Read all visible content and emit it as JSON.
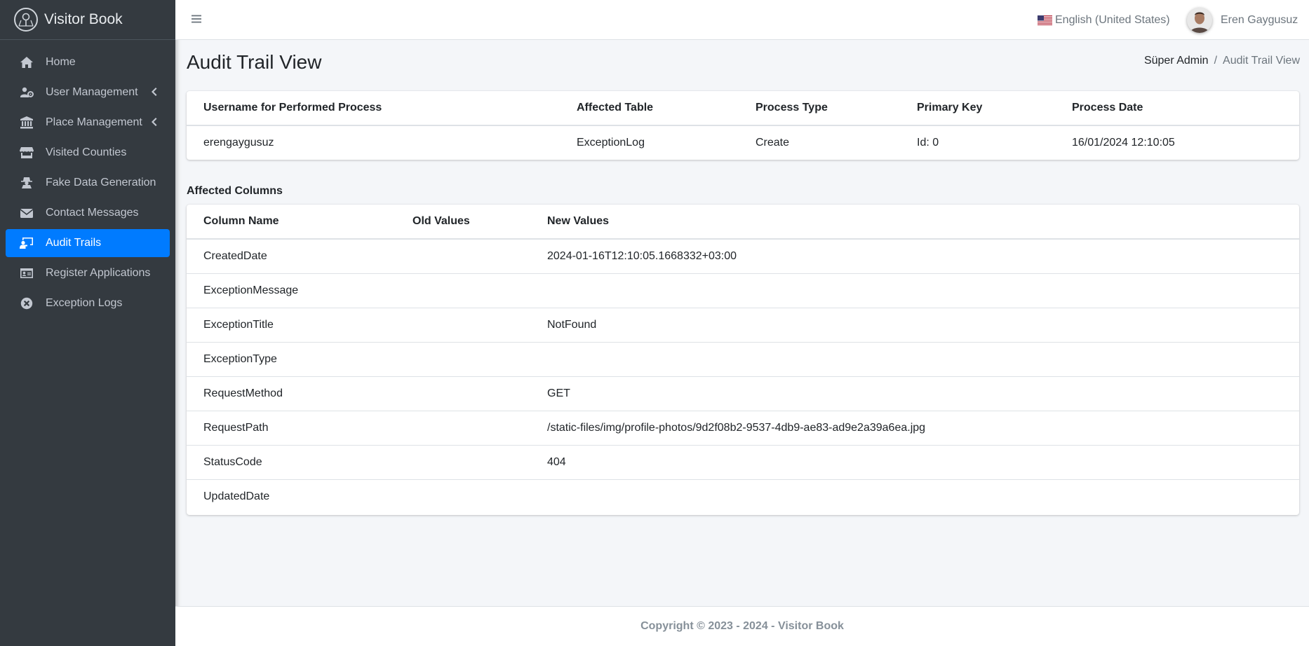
{
  "app": {
    "brand": "Visitor Book"
  },
  "sidebar": {
    "items": [
      {
        "label": "Home",
        "icon": "home-icon"
      },
      {
        "label": "User Management",
        "icon": "users-cog-icon",
        "has_children": true
      },
      {
        "label": "Place Management",
        "icon": "landmark-icon",
        "has_children": true
      },
      {
        "label": "Visited Counties",
        "icon": "store-icon"
      },
      {
        "label": "Fake Data Generation",
        "icon": "user-secret-icon"
      },
      {
        "label": "Contact Messages",
        "icon": "envelope-icon"
      },
      {
        "label": "Audit Trails",
        "icon": "chalkboard-teacher-icon",
        "active": true
      },
      {
        "label": "Register Applications",
        "icon": "id-card-icon"
      },
      {
        "label": "Exception Logs",
        "icon": "times-circle-icon"
      }
    ]
  },
  "topbar": {
    "language": "English (United States)",
    "user_name": "Eren Gaygusuz"
  },
  "page": {
    "title": "Audit Trail View",
    "breadcrumb": {
      "parent": "Süper Admin",
      "separator": "/",
      "current": "Audit Trail View"
    }
  },
  "summary": {
    "headers": [
      "Username for Performed Process",
      "Affected Table",
      "Process Type",
      "Primary Key",
      "Process Date"
    ],
    "row": [
      "erengaygusuz",
      "ExceptionLog",
      "Create",
      "Id: 0",
      "16/01/2024 12:10:05"
    ]
  },
  "affected": {
    "title": "Affected Columns",
    "headers": [
      "Column Name",
      "Old Values",
      "New Values"
    ],
    "rows": [
      {
        "column": "CreatedDate",
        "old": "",
        "new": "2024-01-16T12:10:05.1668332+03:00"
      },
      {
        "column": "ExceptionMessage",
        "old": "",
        "new": ""
      },
      {
        "column": "ExceptionTitle",
        "old": "",
        "new": "NotFound"
      },
      {
        "column": "ExceptionType",
        "old": "",
        "new": ""
      },
      {
        "column": "RequestMethod",
        "old": "",
        "new": "GET"
      },
      {
        "column": "RequestPath",
        "old": "",
        "new": "/static-files/img/profile-photos/9d2f08b2-9537-4db9-ae83-ad9e2a39a6ea.jpg"
      },
      {
        "column": "StatusCode",
        "old": "",
        "new": "404"
      },
      {
        "column": "UpdatedDate",
        "old": "",
        "new": ""
      }
    ]
  },
  "footer": {
    "text": "Copyright © 2023 - 2024 - Visitor Book"
  },
  "colors": {
    "sidebar_bg": "#343a40",
    "active": "#007bff",
    "content_bg": "#f4f6f9"
  }
}
